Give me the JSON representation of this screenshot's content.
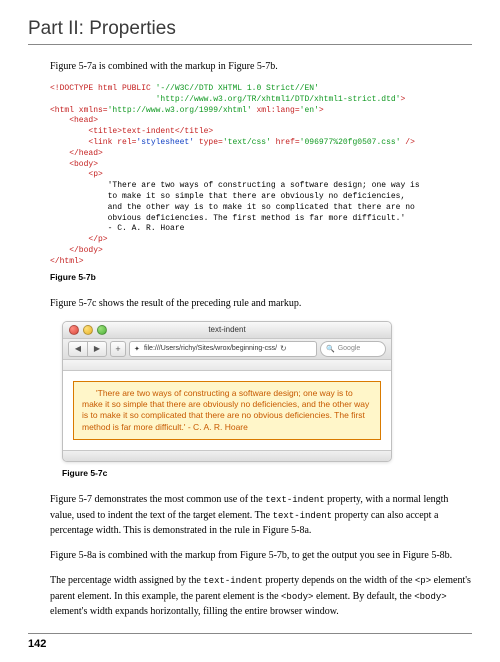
{
  "header": {
    "part_title": "Part II: Properties"
  },
  "intro_para": "Figure 5-7a is combined with the markup in Figure 5-7b.",
  "codeblock_b": {
    "l1a": "<!DOCTYPE html PUBLIC ",
    "l1b": "'-//W3C//DTD XHTML 1.0 Strict//EN'",
    "l2": "'http://www.w3.org/TR/xhtml1/DTD/xhtml1-strict.dtd'",
    "l2end": ">",
    "l3a": "<html xmlns=",
    "l3b": "'http://www.w3.org/1999/xhtml'",
    "l3c": " xml:lang=",
    "l3d": "'en'",
    "l3e": ">",
    "l4": "    <head>",
    "l5": "        <title>text-indent</title>",
    "l6a": "        <link rel=",
    "l6b": "'stylesheet'",
    "l6c": " type=",
    "l6d": "'text/css'",
    "l6e": " href=",
    "l6f": "'096977%20fg0507.css'",
    "l6g": " />",
    "l7": "    </head>",
    "l8": "    <body>",
    "l9": "        <p>",
    "q1": "            'There are two ways of constructing a software design; one way is",
    "q2": "            to make it so simple that there are obviously no deficiencies,",
    "q3": "            and the other way is to make it so complicated that there are no",
    "q4": "            obvious deficiencies. The first method is far more difficult.'",
    "q5": "            - C. A. R. Hoare",
    "l10": "        </p>",
    "l11": "    </body>",
    "l12": "</html>"
  },
  "fig_b_label": "Figure 5-7b",
  "para_c": "Figure 5-7c shows the result of the preceding rule and markup.",
  "browser": {
    "window_title": "text-indent",
    "nav_back": "◀",
    "nav_fwd": "▶",
    "plus": "+",
    "reload": "↻",
    "url_icon": "✦",
    "url_text": "file:///Users/richy/Sites/wrox/beginning-css/",
    "search_placeholder": "Google",
    "quote": "'There are two ways of constructing a software design; one way is to make it so simple that there are obviously no deficiencies, and the other way is to make it so complicated that there are no obvious deficiencies. The first method is far more difficult.' - C. A. R. Hoare"
  },
  "fig_c_label": "Figure 5-7c",
  "para_after_c_pre": "Figure 5-7 demonstrates the most common use of the ",
  "para_after_c_code1": "text-indent",
  "para_after_c_mid": " property, with a normal length value, used to indent the text of the target element. The ",
  "para_after_c_code2": "text-indent",
  "para_after_c_post": " property can also accept a percentage width. This is demonstrated in the rule in Figure 5-8a.",
  "para_8a": "Figure 5-8a is combined with the markup from Figure 5-7b, to get the output you see in Figure 5-8b.",
  "para_last_pre": "The percentage width assigned by the ",
  "para_last_c1": "text-indent",
  "para_last_m1": " property depends on the width of the ",
  "para_last_c2": "<p>",
  "para_last_m2": " element's parent element. In this example, the parent element is the ",
  "para_last_c3": "<body>",
  "para_last_m3": " element. By default, the ",
  "para_last_c4": "<body>",
  "para_last_m4": " element's width expands horizontally, filling the entire browser window.",
  "page_number": "142"
}
